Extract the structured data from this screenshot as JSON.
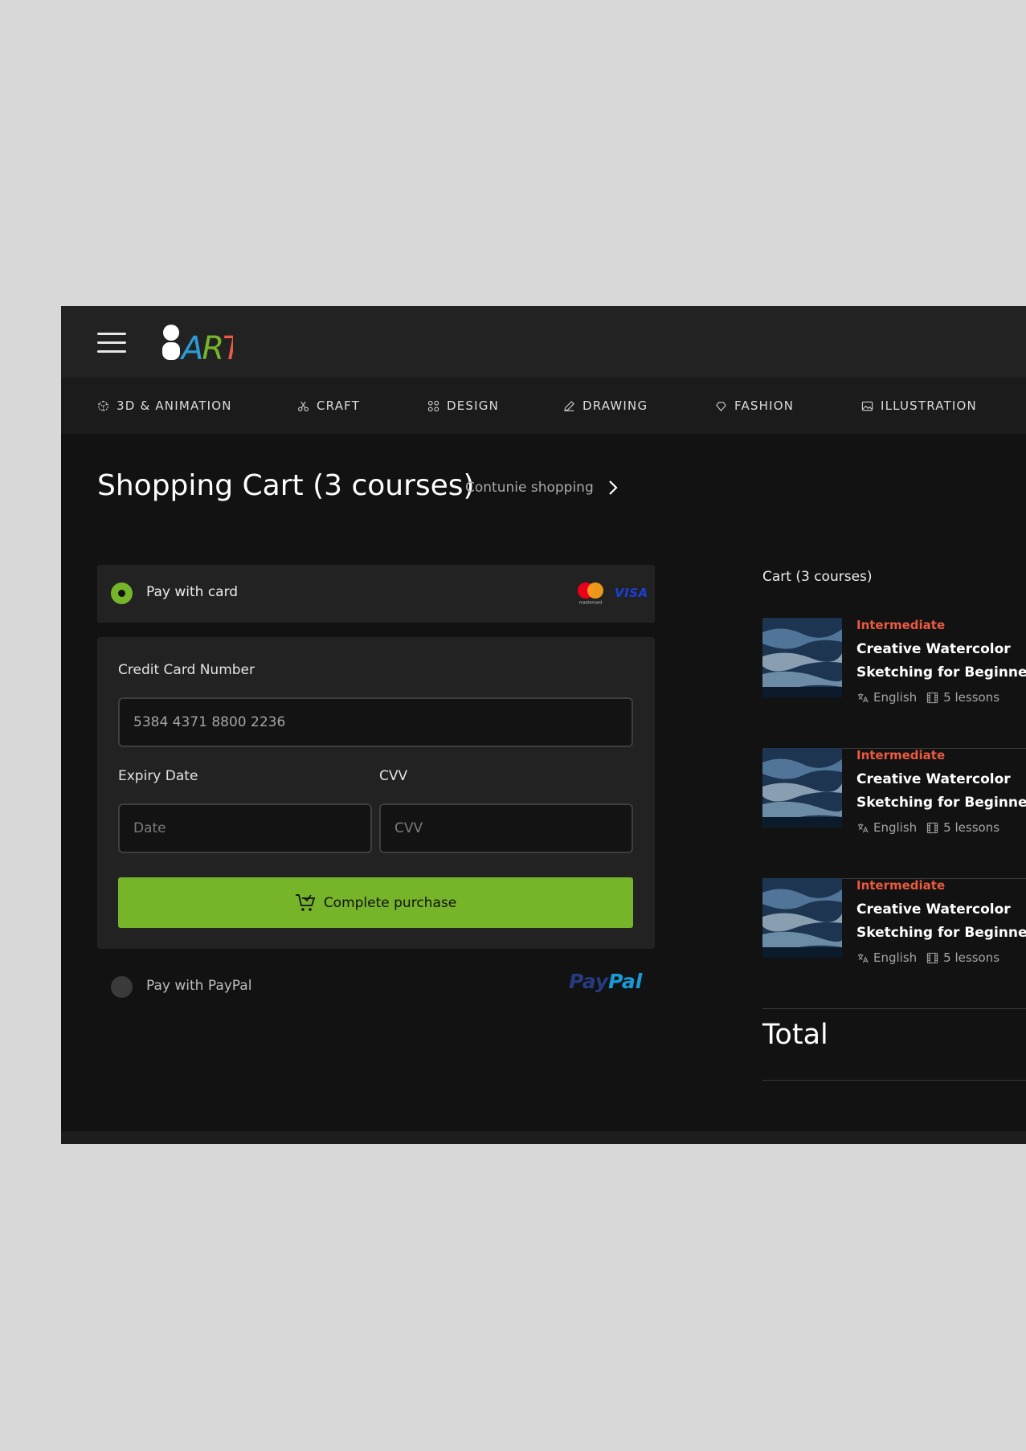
{
  "header": {
    "logo_text": "ART"
  },
  "categories": [
    {
      "label": "3D & ANIMATION",
      "icon": "cube-icon"
    },
    {
      "label": "CRAFT",
      "icon": "scissors-icon"
    },
    {
      "label": "DESIGN",
      "icon": "design-icon"
    },
    {
      "label": "DRAWING",
      "icon": "pencil-icon"
    },
    {
      "label": "FASHION",
      "icon": "diamond-icon"
    },
    {
      "label": "ILLUSTRATION",
      "icon": "image-icon"
    }
  ],
  "page": {
    "title": "Shopping Cart (3 courses)",
    "continue_label": "Contunie shopping"
  },
  "payment": {
    "card_option_label": "Pay with card",
    "card_brand_visa": "VISA",
    "card_brand_mastercard": "mastercard",
    "card_number_label": "Credit Card Number",
    "card_number_value": "5384 4371 8800 2236",
    "expiry_label": "Expiry Date",
    "expiry_placeholder": "Date",
    "cvv_label": "CVV",
    "cvv_placeholder": "CVV",
    "purchase_button_label": "Complete purchase",
    "paypal_option_label": "Pay with PayPal",
    "paypal_logo_pay": "Pay",
    "paypal_logo_pal": "Pal",
    "selected": "card"
  },
  "cart": {
    "title": "Cart (3 courses)",
    "items": [
      {
        "level": "Intermediate",
        "title": "Creative Watercolor Sketching for Beginners",
        "language": "English",
        "lessons": "5 lessons"
      },
      {
        "level": "Intermediate",
        "title": "Creative Watercolor Sketching for Beginners",
        "language": "English",
        "lessons": "5 lessons"
      },
      {
        "level": "Intermediate",
        "title": "Creative Watercolor Sketching for Beginners",
        "language": "English",
        "lessons": "5 lessons"
      }
    ],
    "total_label": "Total"
  },
  "colors": {
    "accent": "#76b42a",
    "level": "#ea5a40",
    "background": "#121212",
    "panel": "#222222"
  }
}
